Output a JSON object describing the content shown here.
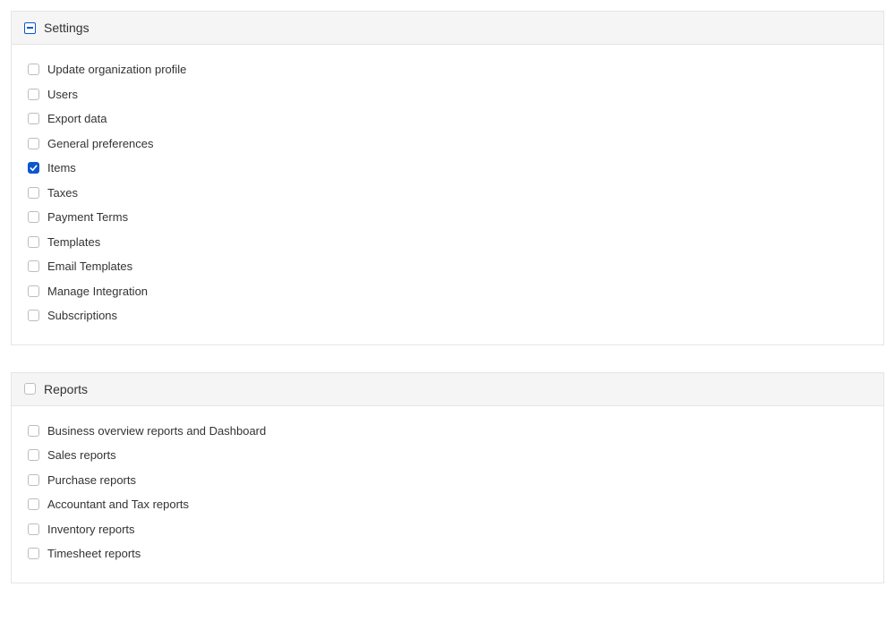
{
  "sections": [
    {
      "key": "settings",
      "title": "Settings",
      "header_state": "indeterminate",
      "items": [
        {
          "label": "Update organization profile",
          "checked": false
        },
        {
          "label": "Users",
          "checked": false
        },
        {
          "label": "Export data",
          "checked": false
        },
        {
          "label": "General preferences",
          "checked": false
        },
        {
          "label": "Items",
          "checked": true
        },
        {
          "label": "Taxes",
          "checked": false
        },
        {
          "label": "Payment Terms",
          "checked": false
        },
        {
          "label": "Templates",
          "checked": false
        },
        {
          "label": "Email Templates",
          "checked": false
        },
        {
          "label": "Manage Integration",
          "checked": false
        },
        {
          "label": "Subscriptions",
          "checked": false
        }
      ]
    },
    {
      "key": "reports",
      "title": "Reports",
      "header_state": "unchecked",
      "items": [
        {
          "label": "Business overview reports and Dashboard",
          "checked": false
        },
        {
          "label": "Sales reports",
          "checked": false
        },
        {
          "label": "Purchase reports",
          "checked": false
        },
        {
          "label": "Accountant and Tax reports",
          "checked": false
        },
        {
          "label": "Inventory reports",
          "checked": false
        },
        {
          "label": "Timesheet reports",
          "checked": false
        }
      ]
    }
  ]
}
